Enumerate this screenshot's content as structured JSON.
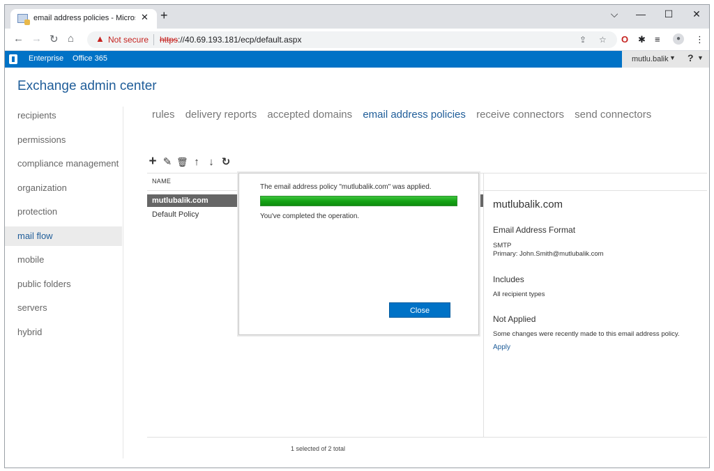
{
  "browser": {
    "tab_title": "email address policies - Microsof",
    "tab_close": "✕",
    "new_tab": "+",
    "window_controls": [
      "⌵",
      "—",
      "☐",
      "✕"
    ],
    "not_secure_label": "Not secure",
    "url_scheme": "https",
    "url_rest": "://40.69.193.181/ecp/default.aspx"
  },
  "eac_bar": {
    "enterprise": "Enterprise",
    "office365": "Office 365",
    "username": "mutlu.balik",
    "help": "?"
  },
  "page_title": "Exchange admin center",
  "left_nav": [
    "recipients",
    "permissions",
    "compliance management",
    "organization",
    "protection",
    "mail flow",
    "mobile",
    "public folders",
    "servers",
    "hybrid"
  ],
  "left_nav_selected": "mail flow",
  "sub_nav": [
    "rules",
    "delivery reports",
    "accepted domains",
    "email address policies",
    "receive connectors",
    "send connectors"
  ],
  "sub_nav_active": "email address policies",
  "list": {
    "column_name": "NAME",
    "rows": [
      "mutlubalik.com",
      "Default Policy"
    ],
    "status": "1 selected of 2 total"
  },
  "details": {
    "title": "mutlubalik.com",
    "format_heading": "Email Address Format",
    "format_type": "SMTP",
    "format_primary": "Primary: John.Smith@mutlubalik.com",
    "includes_heading": "Includes",
    "includes_value": "All recipient types",
    "not_applied_heading": "Not Applied",
    "not_applied_text": "Some changes were recently made to this email address policy.",
    "apply_link": "Apply"
  },
  "dialog": {
    "message": "The email address policy \"mutlubalik.com\" was applied.",
    "progress": 1.0,
    "completed": "You've completed the operation.",
    "close_label": "Close"
  }
}
